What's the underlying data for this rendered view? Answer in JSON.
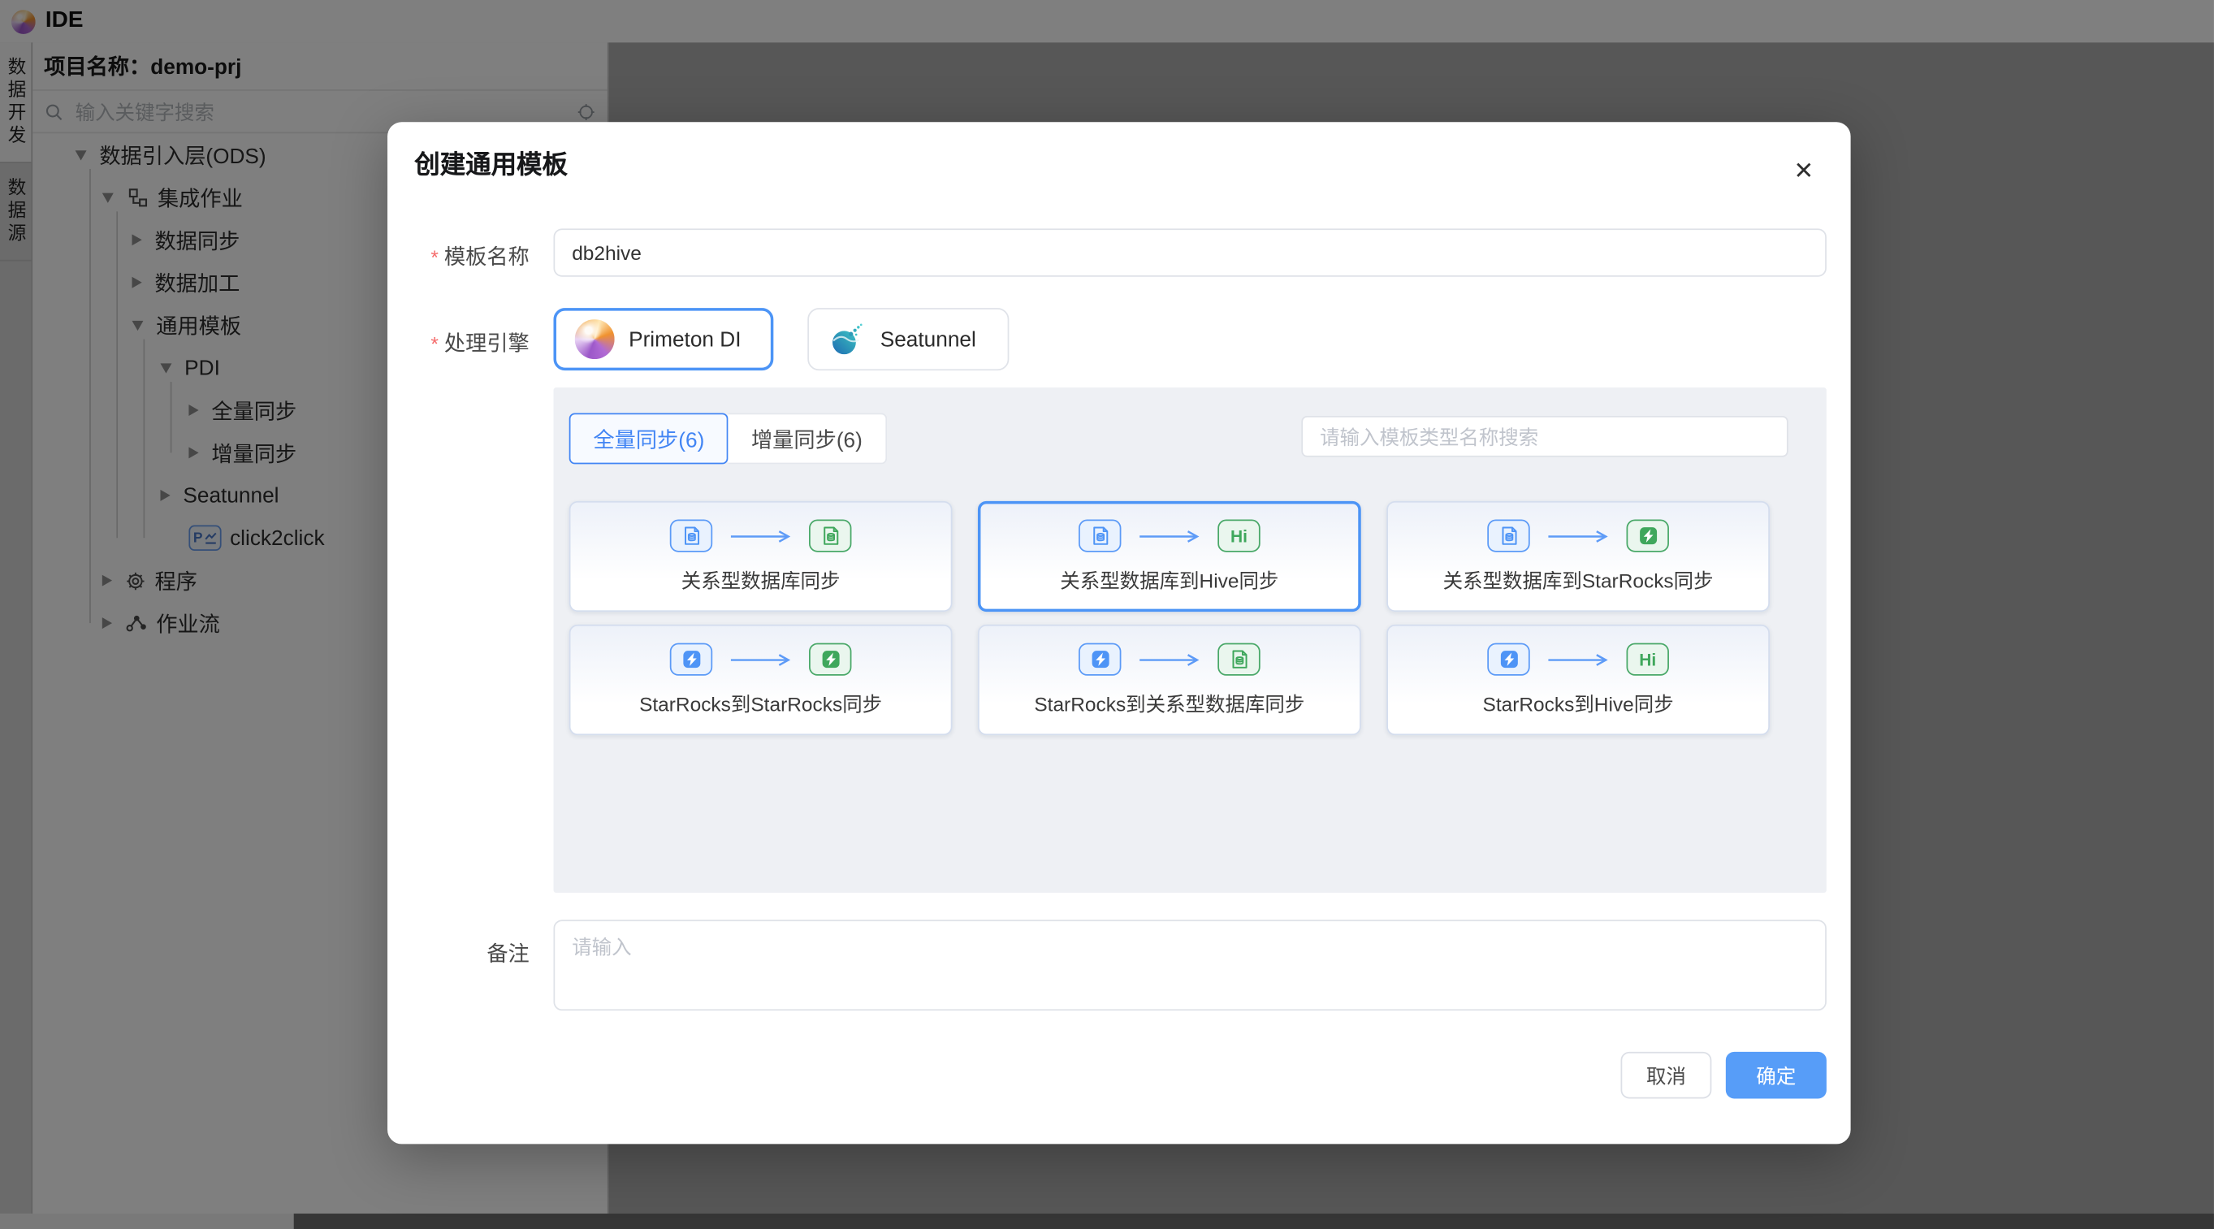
{
  "header": {
    "app_title": "IDE",
    "logo": "primeton-logo"
  },
  "vertical_tabs": [
    {
      "label": "数据开发",
      "active": true
    },
    {
      "label": "数据源",
      "active": false
    }
  ],
  "sidebar": {
    "project_label": "项目名称：demo-prj",
    "search_placeholder": "输入关键字搜索",
    "tree": [
      {
        "label": "数据引入层(ODS)",
        "level": 0,
        "arrow": "down",
        "icon": null
      },
      {
        "label": "集成作业",
        "level": 1,
        "arrow": "down",
        "icon": "integration"
      },
      {
        "label": "数据同步",
        "level": 2,
        "arrow": "right",
        "icon": null
      },
      {
        "label": "数据加工",
        "level": 2,
        "arrow": "right",
        "icon": null
      },
      {
        "label": "通用模板",
        "level": 2,
        "arrow": "down",
        "icon": null
      },
      {
        "label": "PDI",
        "level": 3,
        "arrow": "down",
        "icon": null
      },
      {
        "label": "全量同步",
        "level": 4,
        "arrow": "right",
        "icon": null
      },
      {
        "label": "增量同步",
        "level": 4,
        "arrow": "right",
        "icon": null
      },
      {
        "label": "Seatunnel",
        "level": 3,
        "arrow": "right",
        "icon": null
      },
      {
        "label": "click2click",
        "level": 4,
        "arrow": "none",
        "icon": "pdi-file"
      },
      {
        "label": "程序",
        "level": 1,
        "arrow": "right",
        "icon": "gear"
      },
      {
        "label": "作业流",
        "level": 1,
        "arrow": "right",
        "icon": "flow"
      }
    ]
  },
  "modal": {
    "title": "创建通用模板",
    "close_glyph": "✕",
    "required_mark": "*",
    "fields": {
      "name": {
        "label": "模板名称",
        "required": true,
        "value": "db2hive"
      },
      "engine": {
        "label": "处理引擎",
        "required": true,
        "options": [
          {
            "name": "Primeton DI",
            "logo": "primeton",
            "selected": true
          },
          {
            "name": "Seatunnel",
            "logo": "seatunnel",
            "selected": false
          }
        ]
      },
      "remark": {
        "label": "备注",
        "required": false,
        "placeholder": "请输入"
      }
    },
    "template_panel": {
      "tabs": [
        {
          "label": "全量同步(6)",
          "active": true
        },
        {
          "label": "增量同步(6)",
          "active": false
        }
      ],
      "search_placeholder": "请输入模板类型名称搜索",
      "cards": [
        {
          "label": "关系型数据库同步",
          "source": "db-doc",
          "target": "db-doc",
          "selected": false
        },
        {
          "label": "关系型数据库到Hive同步",
          "source": "db-doc",
          "target": "hi",
          "selected": true
        },
        {
          "label": "关系型数据库到StarRocks同步",
          "source": "db-doc",
          "target": "starrocks",
          "selected": false
        },
        {
          "label": "StarRocks到StarRocks同步",
          "source": "starrocks",
          "target": "starrocks",
          "selected": false
        },
        {
          "label": "StarRocks到关系型数据库同步",
          "source": "starrocks",
          "target": "db-doc",
          "selected": false
        },
        {
          "label": "StarRocks到Hive同步",
          "source": "starrocks",
          "target": "hi",
          "selected": false
        }
      ]
    },
    "footer": {
      "cancel": "取消",
      "ok": "确定"
    }
  },
  "colors": {
    "primary": "#4285f4",
    "ok_button": "#579df8",
    "icon_blue": "#4e94f6",
    "icon_green": "#3fa75c",
    "required": "#f56c6c",
    "mask": "rgba(0,0,0,0.5)"
  }
}
